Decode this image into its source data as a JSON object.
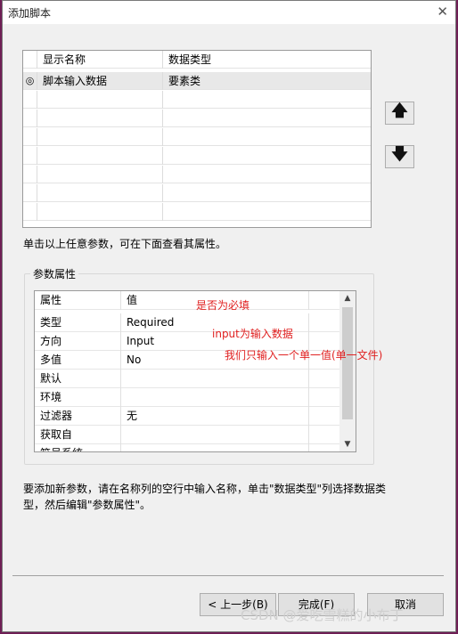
{
  "window": {
    "title": "添加脚本",
    "close_glyph": "✕"
  },
  "param_table": {
    "headers": [
      "显示名称",
      "数据类型"
    ],
    "rows": [
      {
        "marker": "◎",
        "name": "脚本输入数据",
        "type": "要素类"
      }
    ]
  },
  "move_buttons": {
    "up_glyph": "🡅",
    "down_glyph": "🡇"
  },
  "hint_top": "单击以上任意参数，可在下面查看其属性。",
  "properties": {
    "group_label": "参数属性",
    "headers": [
      "属性",
      "值"
    ],
    "rows": [
      {
        "key": "类型",
        "value": "Required"
      },
      {
        "key": "方向",
        "value": "Input"
      },
      {
        "key": "多值",
        "value": "No"
      },
      {
        "key": "默认",
        "value": ""
      },
      {
        "key": "环境",
        "value": ""
      },
      {
        "key": "过滤器",
        "value": "无"
      },
      {
        "key": "获取自",
        "value": ""
      },
      {
        "key": "符号系统",
        "value": ""
      }
    ]
  },
  "annotations": {
    "required": "是否为必填",
    "input": "input为输入数据",
    "single": "我们只输入一个单一值(单一文件)"
  },
  "hint_bottom": "要添加新参数，请在名称列的空行中输入名称，单击\"数据类型\"列选择数据类型，然后编辑\"参数属性\"。",
  "buttons": {
    "back": "< 上一步(B)",
    "finish": "完成(F)",
    "cancel": "取消"
  },
  "watermark": "CSDN @爱吃雪糕的小布丁",
  "colors": {
    "annotation": "#e02020",
    "desktop": "#6e1e55"
  }
}
